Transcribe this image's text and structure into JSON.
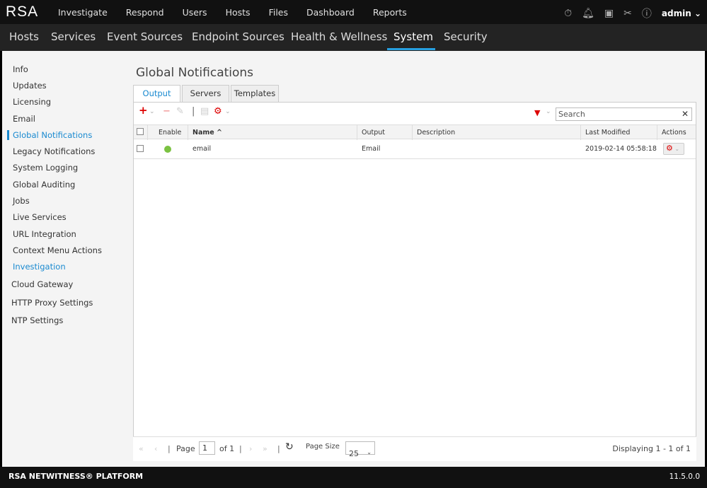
{
  "top": {
    "logo": "RSA",
    "nav": [
      "Investigate",
      "Respond",
      "Users",
      "Hosts",
      "Files",
      "Dashboard",
      "Reports"
    ],
    "user": "admin"
  },
  "subnav": {
    "items": [
      "Hosts",
      "Services",
      "Event Sources",
      "Endpoint Sources",
      "Health & Wellness",
      "System",
      "Security"
    ],
    "active": "System"
  },
  "sidebar": {
    "items": [
      "Info",
      "Updates",
      "Licensing",
      "Email",
      "Global Notifications",
      "Legacy Notifications",
      "System Logging",
      "Global Auditing",
      "Jobs",
      "Live Services",
      "URL Integration",
      "Context Menu Actions",
      "Investigation",
      "Cloud Gateway",
      "HTTP Proxy Settings",
      "NTP Settings"
    ],
    "active": "Global Notifications"
  },
  "page": {
    "title": "Global Notifications",
    "tabs": [
      "Output",
      "Servers",
      "Templates"
    ],
    "active_tab": "Output",
    "search_placeholder": "Search"
  },
  "table": {
    "columns": [
      "Enable",
      "Name ^",
      "Output",
      "Description",
      "Last Modified",
      "Actions"
    ],
    "rows": [
      {
        "enabled": true,
        "name": "email",
        "output": "Email",
        "description": "",
        "last_modified": "2019-02-14 05:58:18"
      }
    ]
  },
  "pager": {
    "page_label": "Page",
    "page": "1",
    "of": "of 1",
    "page_size_label": "Page Size",
    "page_size": "25",
    "displaying": "Displaying 1 - 1 of 1"
  },
  "footer": {
    "brand": "RSA NETWITNESS® PLATFORM",
    "version": "11.5.0.0"
  },
  "colors": {
    "accent": "#1a8ad0",
    "enabled": "#7bc242",
    "action_red": "#d00000"
  }
}
